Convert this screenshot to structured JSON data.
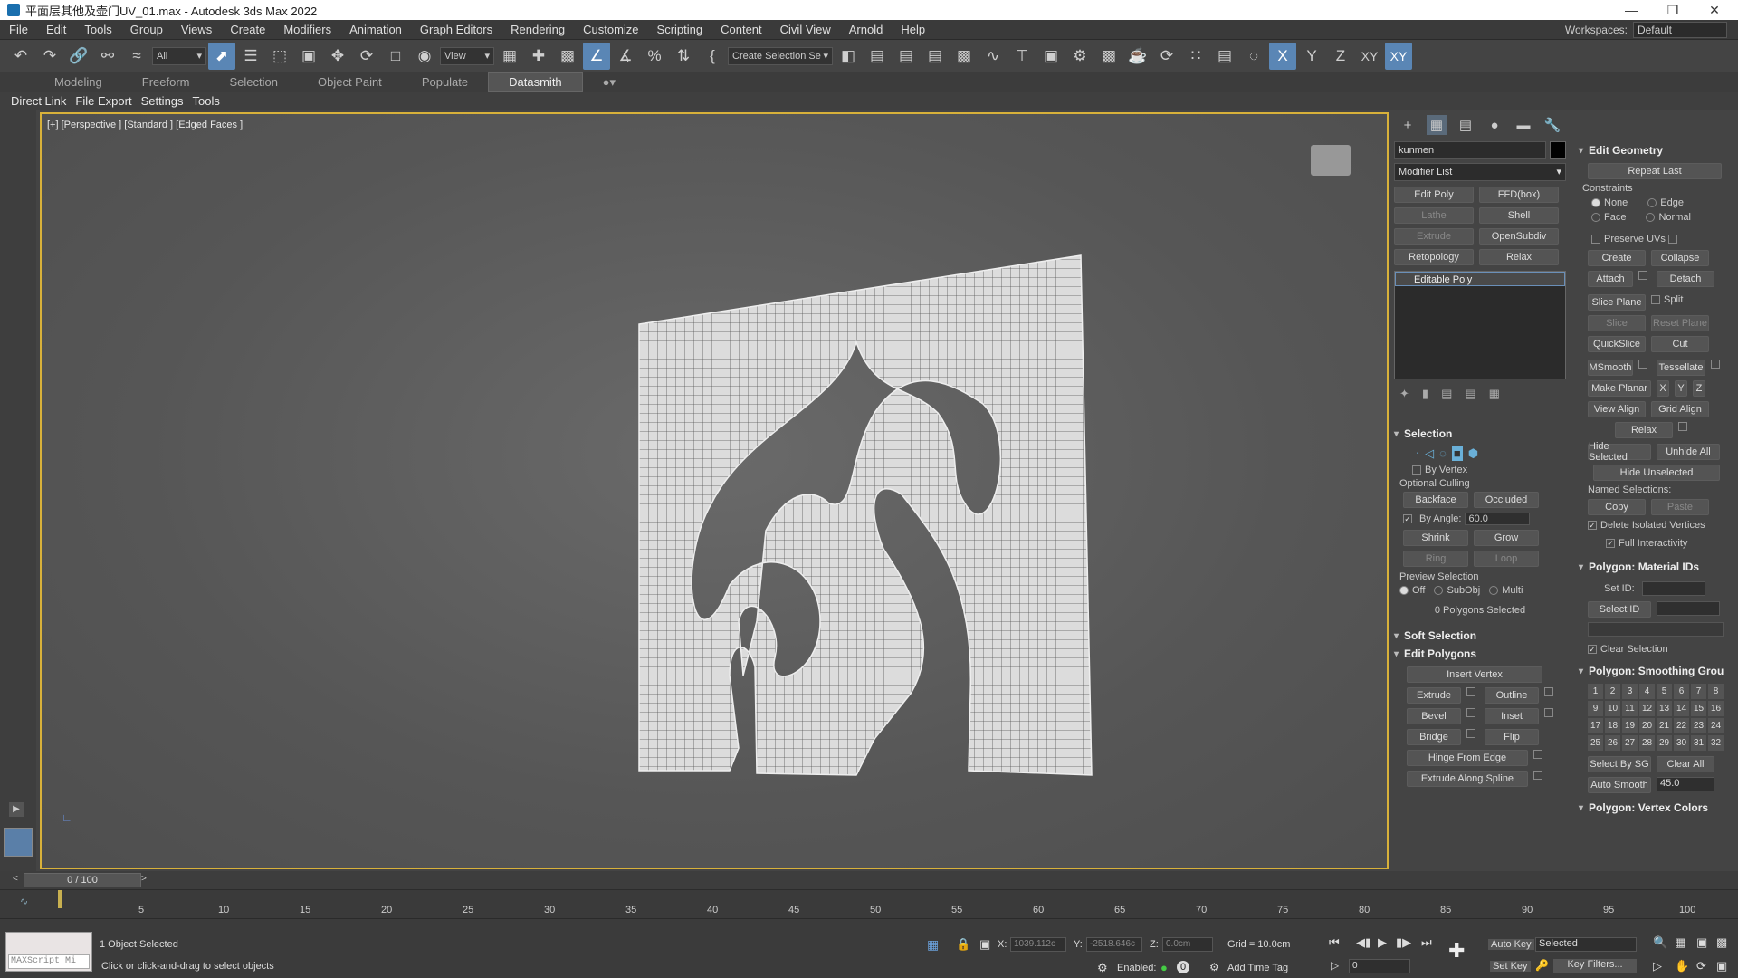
{
  "titlebar": {
    "title": "平面层其他及壶门UV_01.max - Autodesk 3ds Max 2022"
  },
  "menu": {
    "items": [
      "File",
      "Edit",
      "Tools",
      "Group",
      "Views",
      "Create",
      "Modifiers",
      "Animation",
      "Graph Editors",
      "Rendering",
      "Customize",
      "Scripting",
      "Content",
      "Civil View",
      "Arnold",
      "Help"
    ],
    "workspaces_label": "Workspaces:",
    "workspaces_value": "Default"
  },
  "toolbar": {
    "filter_value": "All",
    "refcoord_value": "View",
    "selset_value": "Create Selection Se",
    "axes": [
      "X",
      "Y",
      "Z",
      "XY",
      "XY"
    ]
  },
  "ribbon": {
    "tabs": [
      "Modeling",
      "Freeform",
      "Selection",
      "Object Paint",
      "Populate",
      "Datasmith"
    ],
    "active": "Datasmith"
  },
  "subbar": {
    "items": [
      "Direct Link",
      "File Export",
      "Settings",
      "Tools"
    ]
  },
  "viewport": {
    "label": "[+] [Perspective ] [Standard ] [Edged Faces ]"
  },
  "cmd": {
    "object_name": "kunmen",
    "modifier_list": "Modifier List",
    "mod_buttons": [
      "Edit Poly",
      "FFD(box)",
      "Lathe",
      "Shell",
      "Extrude",
      "OpenSubdiv",
      "Retopology",
      "Relax"
    ],
    "stack_item": "Editable Poly",
    "selection": {
      "title": "Selection",
      "by_vertex": "By Vertex",
      "optional_culling": "Optional Culling",
      "backface": "Backface",
      "occluded": "Occluded",
      "by_angle": "By Angle:",
      "angle_value": "60.0",
      "shrink": "Shrink",
      "grow": "Grow",
      "ring": "Ring",
      "loop": "Loop",
      "preview_selection": "Preview Selection",
      "off": "Off",
      "subobj": "SubObj",
      "multi": "Multi",
      "count": "0 Polygons Selected"
    },
    "soft_selection": "Soft Selection",
    "edit_polygons": {
      "title": "Edit Polygons",
      "insert_vertex": "Insert Vertex",
      "extrude": "Extrude",
      "outline": "Outline",
      "bevel": "Bevel",
      "inset": "Inset",
      "bridge": "Bridge",
      "flip": "Flip",
      "hinge": "Hinge From Edge",
      "extrude_spline": "Extrude Along Spline"
    },
    "edit_geometry": {
      "title": "Edit Geometry",
      "repeat_last": "Repeat Last",
      "constraints": "Constraints",
      "none": "None",
      "edge": "Edge",
      "face": "Face",
      "normal": "Normal",
      "preserve_uvs": "Preserve UVs",
      "create": "Create",
      "collapse": "Collapse",
      "attach": "Attach",
      "detach": "Detach",
      "slice_plane": "Slice Plane",
      "split": "Split",
      "slice": "Slice",
      "reset_plane": "Reset Plane",
      "quickslice": "QuickSlice",
      "cut": "Cut",
      "msmooth": "MSmooth",
      "tessellate": "Tessellate",
      "make_planar": "Make Planar",
      "x": "X",
      "y": "Y",
      "z": "Z",
      "view_align": "View Align",
      "grid_align": "Grid Align",
      "relax": "Relax",
      "hide_selected": "Hide Selected",
      "unhide_all": "Unhide All",
      "hide_unselected": "Hide Unselected",
      "named_selections": "Named Selections:",
      "copy": "Copy",
      "paste": "Paste",
      "delete_isolated": "Delete Isolated Vertices",
      "full_interactivity": "Full Interactivity"
    },
    "material_ids": {
      "title": "Polygon: Material IDs",
      "set_id": "Set ID:",
      "select_id": "Select ID",
      "clear_selection": "Clear Selection"
    },
    "smoothing": {
      "title": "Polygon: Smoothing Grou",
      "numbers": [
        "1",
        "2",
        "3",
        "4",
        "5",
        "6",
        "7",
        "8",
        "9",
        "10",
        "11",
        "12",
        "13",
        "14",
        "15",
        "16",
        "17",
        "18",
        "19",
        "20",
        "21",
        "22",
        "23",
        "24",
        "25",
        "26",
        "27",
        "28",
        "29",
        "30",
        "31",
        "32"
      ],
      "select_by_sg": "Select By SG",
      "clear_all": "Clear All",
      "auto_smooth": "Auto Smooth",
      "auto_smooth_value": "45.0"
    },
    "vertex_colors": "Polygon: Vertex Colors"
  },
  "timeline": {
    "frame": "0 / 100",
    "ticks": [
      "5",
      "10",
      "15",
      "20",
      "25",
      "30",
      "35",
      "40",
      "45",
      "50",
      "55",
      "60",
      "65",
      "70",
      "75",
      "80",
      "85",
      "90",
      "95",
      "100"
    ]
  },
  "status": {
    "maxscript": "MAXScript Mi",
    "objects_selected": "1 Object Selected",
    "prompt": "Click or click-and-drag to select objects",
    "x_label": "X:",
    "x_value": "1039.112c",
    "y_label": "Y:",
    "y_value": "-2518.646c",
    "z_label": "Z:",
    "z_value": "0.0cm",
    "grid": "Grid = 10.0cm",
    "enabled": "Enabled:",
    "enabled_value": "0",
    "add_time_tag": "Add Time Tag",
    "auto_key": "Auto Key",
    "set_key": "Set Key",
    "selected": "Selected",
    "key_filters": "Key Filters...",
    "frame_value": "0"
  }
}
